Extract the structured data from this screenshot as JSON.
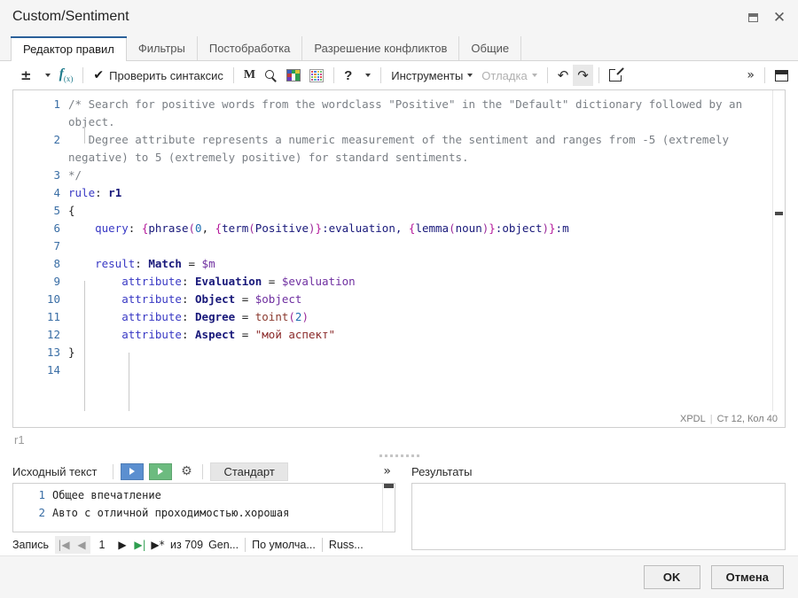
{
  "window": {
    "title": "Custom/Sentiment",
    "restore_label": "Restore",
    "close_label": "Close"
  },
  "tabs": [
    {
      "label": "Редактор правил",
      "active": true
    },
    {
      "label": "Фильтры",
      "active": false
    },
    {
      "label": "Постобработка",
      "active": false
    },
    {
      "label": "Разрешение конфликтов",
      "active": false
    },
    {
      "label": "Общие",
      "active": false
    }
  ],
  "toolbar": {
    "plusminus_label": "±",
    "fx_label": "f",
    "fx_sub": "(x)",
    "check_syntax_label": "Проверить синтаксис",
    "macro_label": "M",
    "search_label": "search-icon",
    "dict_label": "dictionary-icon",
    "palette_label": "palette-icon",
    "help_label": "?",
    "tools_label": "Инструменты",
    "debug_label": "Отладка",
    "undo_label": "↶",
    "redo_label": "↷",
    "external_label": "open-external",
    "overflow_label": "»",
    "panel_label": "panel-toggle"
  },
  "editor": {
    "lines": [
      {
        "num": "1",
        "tokens": [
          {
            "t": "/* Search for positive words from the wordclass \"Positive\" in the \"Default\" dictionary followed by an object.",
            "c": "tk-comment"
          }
        ]
      },
      {
        "num": "2",
        "tokens": [
          {
            "t": "   Degree attribute represents a numeric measurement of the sentiment and ranges from -5 (extremely negative) to 5 (extremely positive) for standard sentiments.",
            "c": "tk-comment"
          }
        ]
      },
      {
        "num": "3",
        "tokens": [
          {
            "t": "*/",
            "c": "tk-comment"
          }
        ]
      },
      {
        "num": "4",
        "tokens": [
          {
            "t": "rule",
            "c": "tk-kw"
          },
          {
            "t": ": ",
            "c": "tk-plain"
          },
          {
            "t": "r1",
            "c": "tk-name"
          }
        ]
      },
      {
        "num": "5",
        "tokens": [
          {
            "t": "{",
            "c": "tk-plain"
          }
        ]
      },
      {
        "num": "6",
        "tokens": [
          {
            "t": "    ",
            "c": "tk-plain"
          },
          {
            "t": "query",
            "c": "tk-kw"
          },
          {
            "t": ": ",
            "c": "tk-plain"
          },
          {
            "t": "{",
            "c": "tk-brace"
          },
          {
            "t": "phrase",
            "c": "tk-id"
          },
          {
            "t": "(",
            "c": "tk-paren"
          },
          {
            "t": "0",
            "c": "tk-num"
          },
          {
            "t": ", ",
            "c": "tk-plain"
          },
          {
            "t": "{",
            "c": "tk-brace"
          },
          {
            "t": "term",
            "c": "tk-id"
          },
          {
            "t": "(",
            "c": "tk-paren"
          },
          {
            "t": "Positive",
            "c": "tk-id"
          },
          {
            "t": ")",
            "c": "tk-paren"
          },
          {
            "t": "}",
            "c": "tk-brace"
          },
          {
            "t": ":evaluation, ",
            "c": "tk-id"
          },
          {
            "t": "{",
            "c": "tk-brace"
          },
          {
            "t": "lemma",
            "c": "tk-id"
          },
          {
            "t": "(",
            "c": "tk-paren"
          },
          {
            "t": "noun",
            "c": "tk-id"
          },
          {
            "t": ")",
            "c": "tk-paren"
          },
          {
            "t": "}",
            "c": "tk-brace"
          },
          {
            "t": ":object",
            "c": "tk-id"
          },
          {
            "t": ")",
            "c": "tk-paren"
          },
          {
            "t": "}",
            "c": "tk-brace"
          },
          {
            "t": ":m",
            "c": "tk-id"
          }
        ]
      },
      {
        "num": "7",
        "tokens": [
          {
            "t": "",
            "c": "tk-plain"
          }
        ]
      },
      {
        "num": "8",
        "tokens": [
          {
            "t": "    ",
            "c": "tk-plain"
          },
          {
            "t": "result",
            "c": "tk-kw"
          },
          {
            "t": ": ",
            "c": "tk-plain"
          },
          {
            "t": "Match",
            "c": "tk-name"
          },
          {
            "t": " = ",
            "c": "tk-plain"
          },
          {
            "t": "$m",
            "c": "tk-var"
          }
        ]
      },
      {
        "num": "9",
        "tokens": [
          {
            "t": "        ",
            "c": "tk-plain"
          },
          {
            "t": "attribute",
            "c": "tk-kw"
          },
          {
            "t": ": ",
            "c": "tk-plain"
          },
          {
            "t": "Evaluation",
            "c": "tk-name"
          },
          {
            "t": " = ",
            "c": "tk-plain"
          },
          {
            "t": "$evaluation",
            "c": "tk-var"
          }
        ]
      },
      {
        "num": "10",
        "tokens": [
          {
            "t": "        ",
            "c": "tk-plain"
          },
          {
            "t": "attribute",
            "c": "tk-kw"
          },
          {
            "t": ": ",
            "c": "tk-plain"
          },
          {
            "t": "Object",
            "c": "tk-name"
          },
          {
            "t": " = ",
            "c": "tk-plain"
          },
          {
            "t": "$object",
            "c": "tk-var"
          }
        ]
      },
      {
        "num": "11",
        "tokens": [
          {
            "t": "        ",
            "c": "tk-plain"
          },
          {
            "t": "attribute",
            "c": "tk-kw"
          },
          {
            "t": ": ",
            "c": "tk-plain"
          },
          {
            "t": "Degree",
            "c": "tk-name"
          },
          {
            "t": " = ",
            "c": "tk-plain"
          },
          {
            "t": "toint",
            "c": "tk-func"
          },
          {
            "t": "(",
            "c": "tk-paren"
          },
          {
            "t": "2",
            "c": "tk-num"
          },
          {
            "t": ")",
            "c": "tk-paren"
          }
        ]
      },
      {
        "num": "12",
        "tokens": [
          {
            "t": "        ",
            "c": "tk-plain"
          },
          {
            "t": "attribute",
            "c": "tk-kw"
          },
          {
            "t": ": ",
            "c": "tk-plain"
          },
          {
            "t": "Aspect",
            "c": "tk-name"
          },
          {
            "t": " = ",
            "c": "tk-plain"
          },
          {
            "t": "\"мой аспект\"",
            "c": "tk-str"
          }
        ]
      },
      {
        "num": "13",
        "tokens": [
          {
            "t": "}",
            "c": "tk-plain"
          }
        ]
      },
      {
        "num": "14",
        "tokens": [
          {
            "t": "",
            "c": "tk-plain"
          }
        ]
      }
    ],
    "status_language": "XPDL",
    "status_position": "Ст 12, Кол 40"
  },
  "rule_name": "r1",
  "source_panel": {
    "label": "Исходный текст",
    "run_label": "run",
    "run_alt_label": "run-step",
    "settings_label": "settings",
    "mode_label": "Стандарт",
    "overflow_label": "»",
    "lines": [
      {
        "num": "1",
        "text": "Общее впечатление"
      },
      {
        "num": "2",
        "text": "Авто с отличной проходимостью.хорошая"
      }
    ]
  },
  "record_nav": {
    "label": "Запись",
    "first_label": "|◀",
    "prev_label": "◀",
    "current": "1",
    "next_label": "▶",
    "last_label": "▶|",
    "new_label": "▶*",
    "total_label": "из 709",
    "generator_label": "Gen...",
    "default_label": "По умолча...",
    "language_label": "Russ..."
  },
  "results_panel": {
    "label": "Результаты",
    "content": ""
  },
  "footer": {
    "ok_label": "OK",
    "cancel_label": "Отмена"
  },
  "colors": {
    "accent": "#2a6099",
    "run_blue": "#5b8fd0",
    "run_green": "#6cbb7f",
    "gutter": "#3a6ea5",
    "comment": "#7a7f85",
    "keyword": "#3838c4",
    "brace": "#b5199b",
    "variable": "#6f2fa0",
    "string": "#8b2b2b"
  }
}
